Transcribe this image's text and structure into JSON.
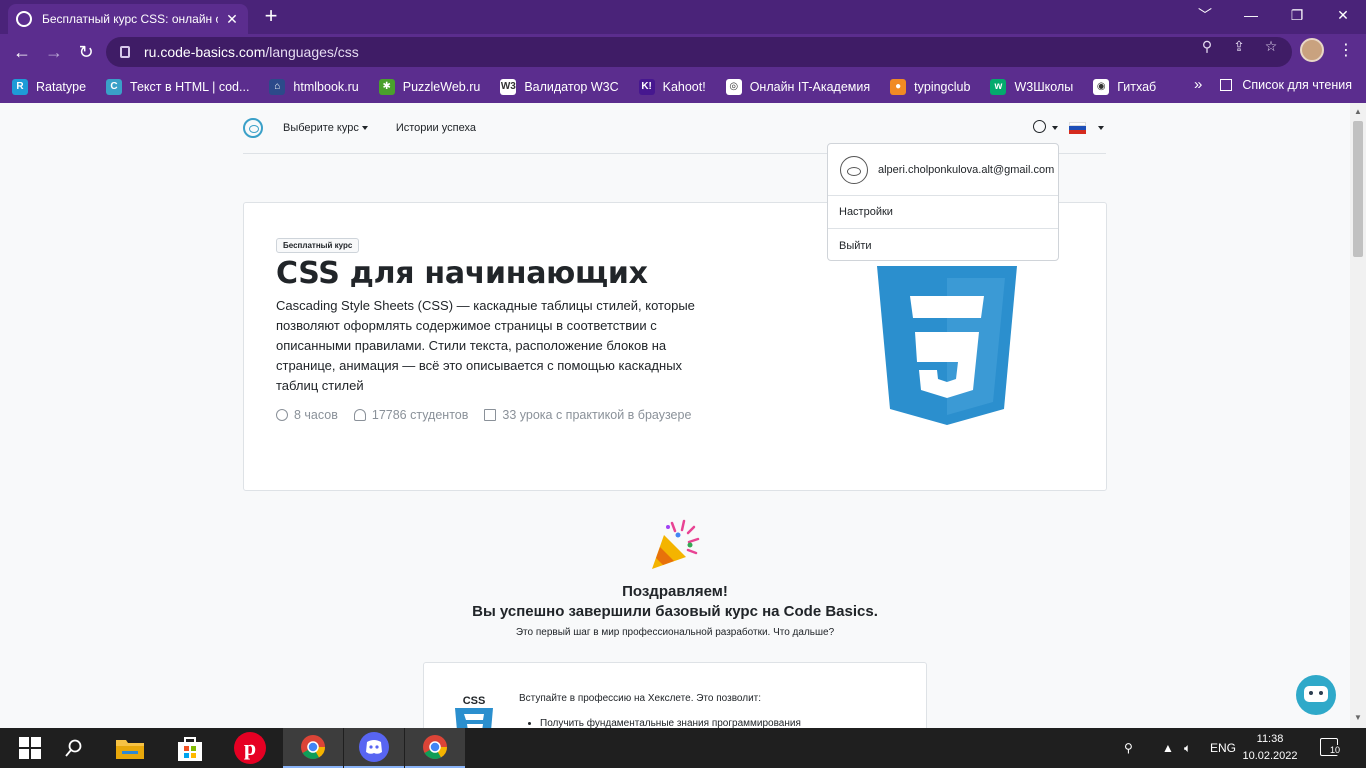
{
  "browser": {
    "tab_title": "Бесплатный курс CSS: онлайн о",
    "tab_close": "✕",
    "new_tab": "+",
    "url_host": "ru.code-basics.com",
    "url_path": "/languages/css",
    "window_controls": [
      "﹀",
      "—",
      "❐",
      "✕"
    ]
  },
  "bookmarks": [
    {
      "label": "Ratatype",
      "icon": "ratatype-icon",
      "color": "#1e9bd7",
      "glyph": "R"
    },
    {
      "label": "Текст в HTML | cod...",
      "icon": "code-basics-icon",
      "color": "#3aa0c8",
      "glyph": "C"
    },
    {
      "label": "htmlbook.ru",
      "icon": "htmlbook-icon",
      "color": "#2c4a8a",
      "glyph": "⌂"
    },
    {
      "label": "PuzzleWeb.ru",
      "icon": "puzzle-icon",
      "color": "#4aa02c",
      "glyph": "✱"
    },
    {
      "label": "Валидатор W3C",
      "icon": "w3c-icon",
      "color": "#ffffff",
      "glyph": "W3"
    },
    {
      "label": "Kahoot!",
      "icon": "kahoot-icon",
      "color": "#46178f",
      "glyph": "K!"
    },
    {
      "label": "Онлайн IT-Академия",
      "icon": "academy-icon",
      "color": "#ffffff",
      "glyph": "◎"
    },
    {
      "label": "typingclub",
      "icon": "typingclub-icon",
      "color": "#f08a24",
      "glyph": "●"
    },
    {
      "label": "W3Школы",
      "icon": "w3schools-icon",
      "color": "#04aa6d",
      "glyph": "w"
    },
    {
      "label": "Гитхаб",
      "icon": "github-icon",
      "color": "#ffffff",
      "glyph": "◉"
    }
  ],
  "bookmarks_more": "»",
  "reading_list": "Список для чтения",
  "site_nav": {
    "choose_course": "Выберите курс",
    "success_stories": "Истории успеха"
  },
  "user_menu": {
    "email": "alperi.cholponkulova.alt@gmail.com",
    "settings": "Настройки",
    "logout": "Выйти"
  },
  "course": {
    "badge": "Бесплатный курс",
    "title": "CSS для начинающих",
    "description": "Cascading Style Sheets (CSS) — каскадные таблицы стилей, которые позволяют оформлять содержимое страницы в соответствии с описанными правилами. Стили текста, расположение блоков на странице, анимация — всё это описывается с помощью каскадных таблиц стилей",
    "hours": "8 часов",
    "students": "17786 студентов",
    "lessons": "33 урока с практикой в браузере",
    "brand_color": "#2b8fce"
  },
  "congrats": {
    "title": "Поздравляем!",
    "subtitle": "Вы успешно завершили базовый курс на Code Basics.",
    "note": "Это первый шаг в мир профессиональной разработки. Что дальше?",
    "card_lead": "Вступайте в профессию на Хекслете. Это позволит:",
    "card_item": "Получить фундаментальные знания программирования",
    "mini_logo": "CSS"
  },
  "taskbar": {
    "lang": "ENG",
    "time": "11:38",
    "date": "10.02.2022",
    "notifications": "10"
  }
}
